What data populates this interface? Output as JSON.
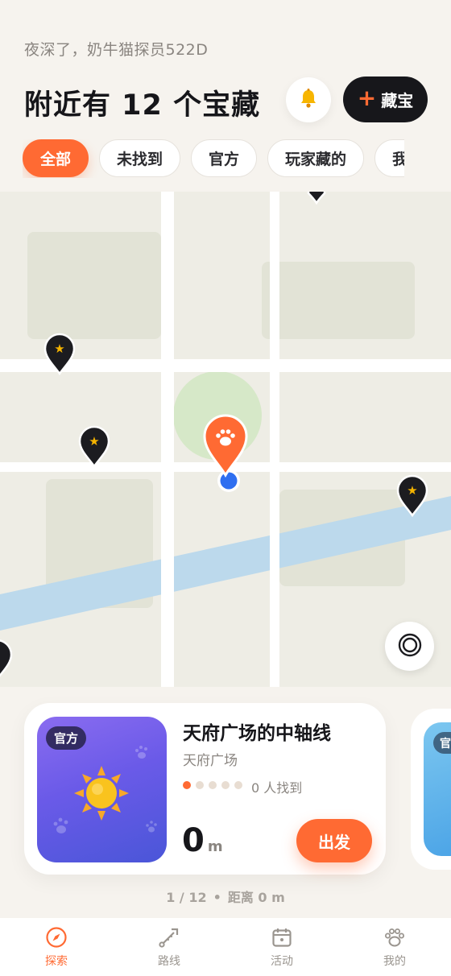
{
  "header": {
    "greeting": "夜深了，奶牛猫探员522D",
    "headline": "附近有 12 个宝藏",
    "bell_icon": "bell-icon",
    "hide_button_label": "藏宝"
  },
  "filters": {
    "selected": "全部",
    "items": [
      {
        "label": "全部"
      },
      {
        "label": "未找到"
      },
      {
        "label": "官方"
      },
      {
        "label": "玩家藏的"
      },
      {
        "label": "我"
      }
    ]
  },
  "map": {
    "marker_icon": "star-pin-icon",
    "current_target_icon": "paw-pin-icon",
    "user_location_icon": "location-dot-icon",
    "locate_button_icon": "target-icon"
  },
  "card": {
    "badge": "官方",
    "title": "天府广场的中轴线",
    "place": "天府广场",
    "progress_dots_total": 5,
    "progress_dots_filled": 1,
    "found_text": "0 人找到",
    "distance_value": "0",
    "distance_unit": "m",
    "go_label": "出发",
    "thumb_icon": "sun-icon"
  },
  "next_card": {
    "badge": "官"
  },
  "pager": {
    "index": "1 / 12",
    "separator": "•",
    "distance_text": "距离 0 m"
  },
  "tabbar": {
    "active": "探索",
    "tabs": [
      {
        "label": "探索",
        "icon": "compass-icon"
      },
      {
        "label": "路线",
        "icon": "route-icon"
      },
      {
        "label": "活动",
        "icon": "calendar-icon"
      },
      {
        "label": "我的",
        "icon": "paw-icon"
      }
    ]
  },
  "colors": {
    "accent": "#ff6a33",
    "dark": "#17171b",
    "background": "#f6f3ee",
    "user_dot": "#2f6ff0",
    "river": "#bcd9ec",
    "park": "#d6e8c8"
  }
}
